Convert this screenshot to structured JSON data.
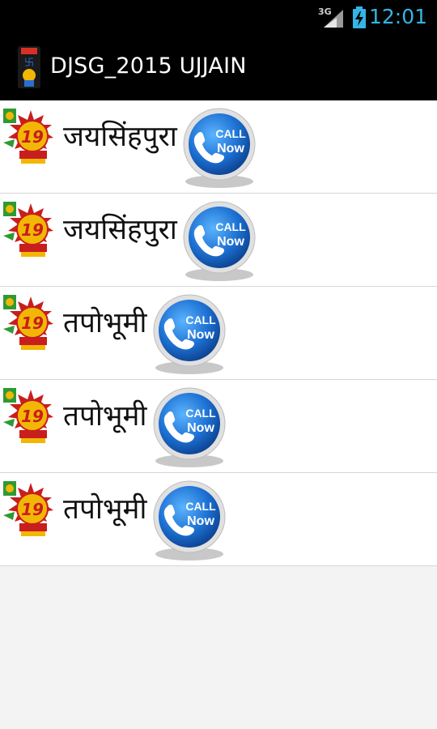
{
  "status_bar": {
    "network": "3G",
    "time": "12:01"
  },
  "app": {
    "title": "DJSG_2015 UJJAIN"
  },
  "entries": [
    {
      "name": "जयसिंहपुरा",
      "call_label_top": "CALL",
      "call_label_bottom": "Now"
    },
    {
      "name": "जयसिंहपुरा",
      "call_label_top": "CALL",
      "call_label_bottom": "Now"
    },
    {
      "name": "तपोभूमी",
      "call_label_top": "CALL",
      "call_label_bottom": "Now"
    },
    {
      "name": "तपोभूमी",
      "call_label_top": "CALL",
      "call_label_bottom": "Now"
    },
    {
      "name": "तपोभूमी",
      "call_label_top": "CALL",
      "call_label_bottom": "Now"
    }
  ],
  "colors": {
    "status_accent": "#33b5e5",
    "call_button": "#1c6fd1",
    "logo_red": "#c81e1e",
    "logo_green": "#2e9a35",
    "logo_gold": "#f2b705"
  },
  "icons": {
    "signal": "signal-icon",
    "battery": "battery-icon",
    "app": "app-logo-icon",
    "row_logo": "emblem-logo-icon",
    "call": "call-now-icon"
  }
}
